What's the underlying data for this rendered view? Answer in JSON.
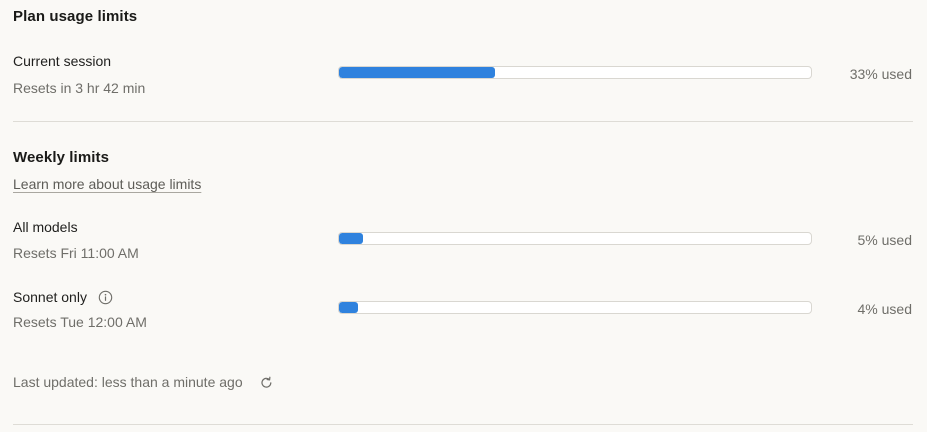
{
  "plan": {
    "title": "Plan usage limits",
    "current_session": {
      "label": "Current session",
      "reset": "Resets in 3 hr 42 min",
      "percent_used": 33,
      "used_text": "33% used"
    }
  },
  "weekly": {
    "title": "Weekly limits",
    "learn_more": "Learn more about usage limits",
    "all_models": {
      "label": "All models",
      "reset": "Resets Fri 11:00 AM",
      "percent_used": 5,
      "used_text": "5% used"
    },
    "sonnet_only": {
      "label": "Sonnet only",
      "reset": "Resets Tue 12:00 AM",
      "percent_used": 4,
      "used_text": "4% used"
    }
  },
  "footer": {
    "last_updated": "Last updated: less than a minute ago"
  },
  "icons": {
    "info": "info-icon",
    "refresh": "refresh-icon"
  },
  "colors": {
    "accent": "#2f82de",
    "background": "#faf9f6"
  }
}
